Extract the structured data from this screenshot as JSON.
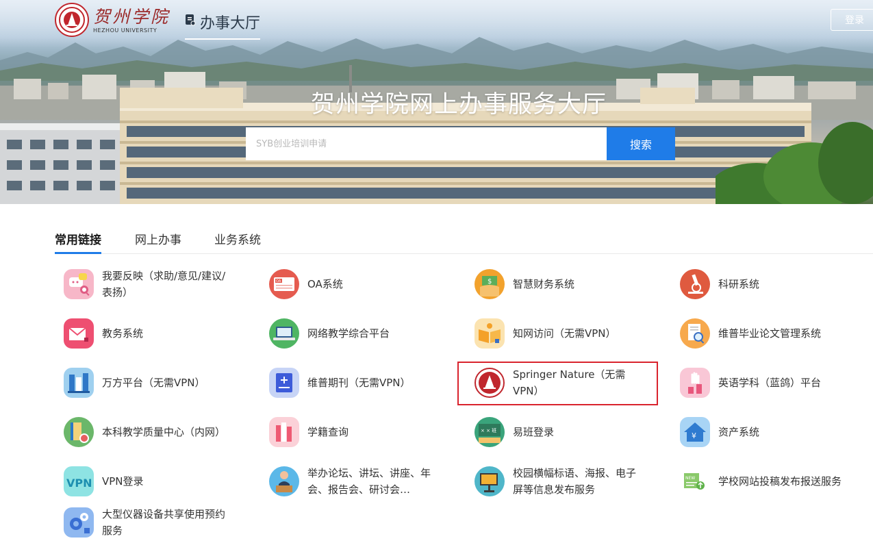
{
  "header": {
    "logo_cn": "贺州学院",
    "logo_en": "HEZHOU UNIVERSITY",
    "hall_label": "办事大厅",
    "login_label": "登录"
  },
  "hero": {
    "title": "贺州学院网上办事服务大厅",
    "search_placeholder": "SYB创业培训申请",
    "search_button": "搜索"
  },
  "tabs": [
    {
      "label": "常用链接",
      "active": true
    },
    {
      "label": "网上办事",
      "active": false
    },
    {
      "label": "业务系统",
      "active": false
    }
  ],
  "links": [
    {
      "label": "我要反映（求助/意见/建议/表扬）",
      "icon": "feedback-chat-icon"
    },
    {
      "label": "OA系统",
      "icon": "oa-icon"
    },
    {
      "label": "智慧财务系统",
      "icon": "finance-money-icon"
    },
    {
      "label": "科研系统",
      "icon": "microscope-icon"
    },
    {
      "label": "教务系统",
      "icon": "mail-envelope-icon"
    },
    {
      "label": "网络教学综合平台",
      "icon": "laptop-icon"
    },
    {
      "label": "知网访问（无需VPN）",
      "icon": "open-book-icon"
    },
    {
      "label": "维普毕业论文管理系统",
      "icon": "document-search-icon"
    },
    {
      "label": "万方平台（无需VPN）",
      "icon": "bookshelf-icon"
    },
    {
      "label": "维普期刊（无需VPN）",
      "icon": "journal-add-icon"
    },
    {
      "label": "Springer Nature（无需VPN）",
      "icon": "university-seal-icon",
      "highlighted": true
    },
    {
      "label": "英语学科（蓝鸽）平台",
      "icon": "raised-hand-icon"
    },
    {
      "label": "本科教学质量中心（内网）",
      "icon": "book-badge-icon"
    },
    {
      "label": "学籍查询",
      "icon": "books-stack-icon"
    },
    {
      "label": "易班登录",
      "icon": "classroom-board-icon"
    },
    {
      "label": "资产系统",
      "icon": "house-asset-icon"
    },
    {
      "label": "VPN登录",
      "icon": "vpn-icon"
    },
    {
      "label": "举办论坛、讲坛、讲座、年会、报告会、研讨会…",
      "icon": "speaker-podium-icon"
    },
    {
      "label": "校园横幅标语、海报、电子屏等信息发布服务",
      "icon": "display-screen-icon"
    },
    {
      "label": "学校网站投稿发布报送服务",
      "icon": "new-upload-icon"
    },
    {
      "label": "大型仪器设备共享使用预约服务",
      "icon": "gears-icon"
    }
  ],
  "colors": {
    "accent": "#1f7ce8",
    "highlight_border": "#d9232d",
    "brand_red": "#c0262d"
  }
}
